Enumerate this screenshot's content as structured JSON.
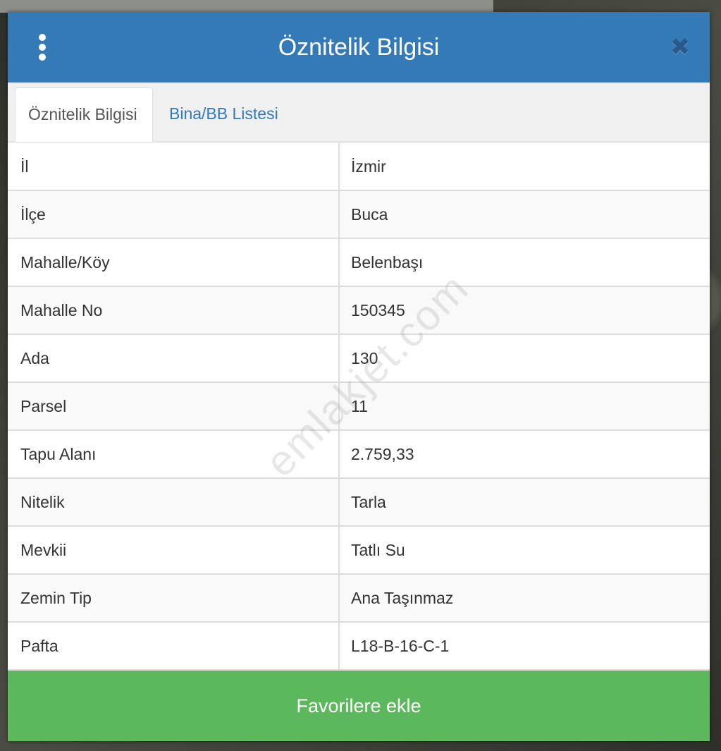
{
  "dialog": {
    "title": "Öznitelik Bilgisi",
    "menu_icon": "kebab-menu-icon",
    "close_icon": "close-icon",
    "close_symbol": "✖"
  },
  "tabs": [
    {
      "label": "Öznitelik Bilgisi",
      "active": true
    },
    {
      "label": "Bina/BB Listesi",
      "active": false
    }
  ],
  "attributes": [
    {
      "key": "İl",
      "value": "İzmir"
    },
    {
      "key": "İlçe",
      "value": "Buca"
    },
    {
      "key": "Mahalle/Köy",
      "value": "Belenbaşı"
    },
    {
      "key": "Mahalle No",
      "value": "150345"
    },
    {
      "key": "Ada",
      "value": "130"
    },
    {
      "key": "Parsel",
      "value": "11"
    },
    {
      "key": "Tapu Alanı",
      "value": "2.759,33"
    },
    {
      "key": "Nitelik",
      "value": "Tarla"
    },
    {
      "key": "Mevkii",
      "value": "Tatlı Su"
    },
    {
      "key": "Zemin Tip",
      "value": "Ana Taşınmaz"
    },
    {
      "key": "Pafta",
      "value": "L18-B-16-C-1"
    }
  ],
  "watermark": "emlakjet.com",
  "footer": {
    "favorite_label": "Favorilere ekle"
  },
  "colors": {
    "header": "#337ab7",
    "tab_link": "#337ab7",
    "favorite_button": "#5cb85c"
  }
}
